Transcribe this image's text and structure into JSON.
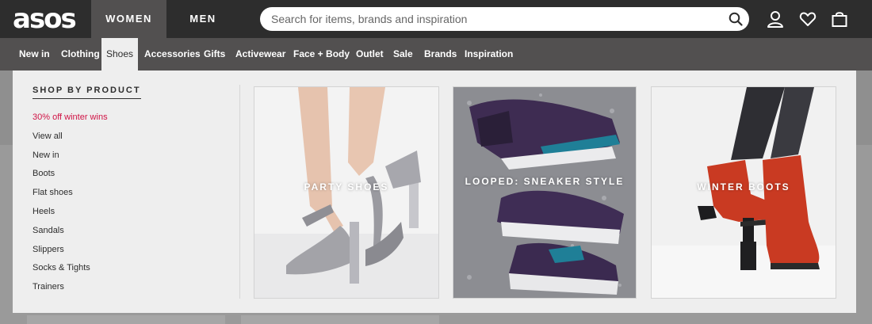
{
  "header": {
    "logo": "asos",
    "gender_tabs": [
      "WOMEN",
      "MEN"
    ],
    "search_placeholder": "Search for items, brands and inspiration"
  },
  "nav": {
    "items": [
      "New in",
      "Clothing",
      "Shoes",
      "Accessories",
      "Gifts",
      "Activewear",
      "Face + Body",
      "Outlet",
      "Sale",
      "Brands",
      "Inspiration"
    ],
    "active": "Shoes"
  },
  "dropdown": {
    "heading": "SHOP BY PRODUCT",
    "links": [
      "30% off winter wins",
      "View all",
      "New in",
      "Boots",
      "Flat shoes",
      "Heels",
      "Sandals",
      "Slippers",
      "Socks & Tights",
      "Trainers"
    ],
    "tiles": [
      "PARTY SHOES",
      "LOOPED: SNEAKER STYLE",
      "WINTER BOOTS"
    ]
  },
  "colors": {
    "topbar": "#2d2d2d",
    "navbar": "#525050",
    "panel": "#eeeeee",
    "promo": "#d01345",
    "boot": "#c93a22",
    "sneaker": "#3e2c52"
  },
  "icons": [
    "search-icon",
    "account-icon",
    "heart-icon",
    "bag-icon"
  ]
}
